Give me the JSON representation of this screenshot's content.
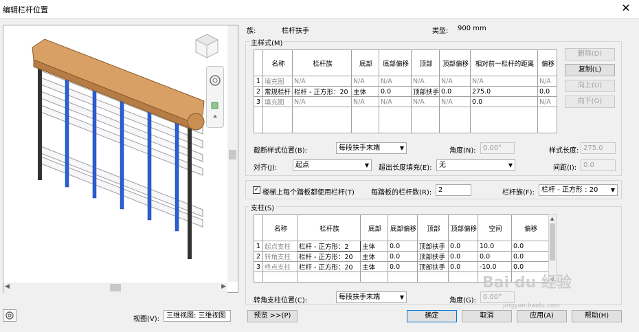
{
  "window": {
    "title": "编辑栏杆位置",
    "close_glyph": "✕"
  },
  "header": {
    "family_label": "族:",
    "family_value": "栏杆扶手",
    "type_label": "类型:",
    "type_value": "900 mm"
  },
  "main_pattern": {
    "group_label": "主样式(M)",
    "columns": [
      "",
      "名称",
      "栏杆族",
      "底部",
      "底部偏移",
      "顶部",
      "顶部偏移",
      "相对前一栏杆的距离",
      "偏移"
    ],
    "rows": [
      {
        "num": "1",
        "name": "填充图",
        "family": "N/A",
        "base": "N/A",
        "base_offset": "N/A",
        "top": "N/A",
        "top_offset": "N/A",
        "distance": "N/A",
        "offset": "N/A"
      },
      {
        "num": "2",
        "name": "常规栏杆",
        "family": "栏杆 - 正方形：20",
        "base": "主体",
        "base_offset": "0.0",
        "top": "顶部扶手",
        "top_offset": "0.0",
        "distance": "275.0",
        "offset": "0.0"
      },
      {
        "num": "3",
        "name": "填充图",
        "family": "N/A",
        "base": "N/A",
        "base_offset": "N/A",
        "top": "N/A",
        "top_offset": "N/A",
        "distance": "0.0",
        "offset": "N/A"
      }
    ],
    "buttons": {
      "delete": "删除(D)",
      "copy": "复制(L)",
      "up": "向上(U)",
      "down": "向下(O)"
    },
    "break_label": "截断样式位置(B):",
    "break_value": "每段扶手末端",
    "angle_label": "角度(N):",
    "angle_value": "0.00°",
    "length_label": "样式长度:",
    "length_value": "275.0",
    "justify_label": "对齐(J):",
    "justify_value": "起点",
    "fill_label": "超出长度填充(E):",
    "fill_value": "无",
    "spacing_label": "间距(I):",
    "spacing_value": "0.0"
  },
  "tread": {
    "checkbox_label": "楼梯上每个踏板都使用栏杆(T)",
    "checked": true,
    "per_tread_label": "每踏板的栏杆数(R):",
    "per_tread_value": "2",
    "family_label": "栏杆族(F):",
    "family_value": "栏杆 - 正方形 : 20"
  },
  "posts": {
    "group_label": "支柱(S)",
    "columns": [
      "",
      "名称",
      "栏杆族",
      "底部",
      "底部偏移",
      "顶部",
      "顶部偏移",
      "空间",
      "偏移"
    ],
    "rows": [
      {
        "num": "1",
        "name": "起点支柱",
        "family": "栏杆 - 正方形：2",
        "base": "主体",
        "base_offset": "0.0",
        "top": "顶部扶手",
        "top_offset": "0.0",
        "space": "10.0",
        "offset": "0.0"
      },
      {
        "num": "2",
        "name": "转角支柱",
        "family": "栏杆 - 正方形：20",
        "base": "主体",
        "base_offset": "0.0",
        "top": "顶部扶手",
        "top_offset": "0.0",
        "space": "0.0",
        "offset": "0.0"
      },
      {
        "num": "3",
        "name": "终点支柱",
        "family": "栏杆 - 正方形：20",
        "base": "主体",
        "base_offset": "0.0",
        "top": "顶部扶手",
        "top_offset": "0.0",
        "space": "-10.0",
        "offset": "0.0"
      }
    ],
    "corner_label": "转角支柱位置(C):",
    "corner_value": "每段扶手末端",
    "angle_label": "角度(G):",
    "angle_value": "0.00°"
  },
  "footer": {
    "view_label": "视图(V):",
    "view_value": "三维视图: 三维视图",
    "preview_button": "预览 >>(P)",
    "ok": "确定",
    "cancel": "取消",
    "apply": "应用(A)",
    "help": "帮助(H)"
  },
  "watermark": {
    "text": "Bai du 经验",
    "sub": "jingyan.baidu.com"
  },
  "colors": {
    "rail_wood": "#d9a066",
    "baluster_blue": "#2a5fd6",
    "post_dark": "#333333",
    "accent": "#0078d7"
  }
}
